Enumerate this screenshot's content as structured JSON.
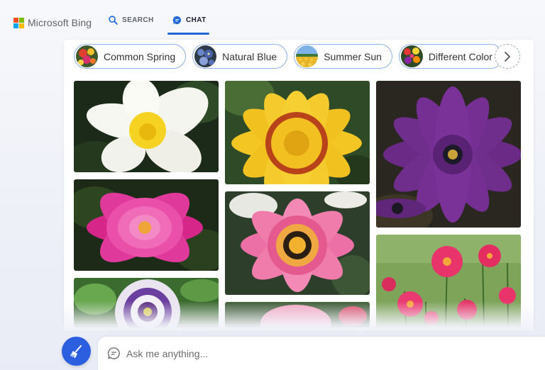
{
  "header": {
    "logo_text": "Microsoft Bing",
    "logo_colors": [
      "#f25022",
      "#7fba00",
      "#00a4ef",
      "#ffb900"
    ],
    "tabs": [
      {
        "label": "SEARCH",
        "active": false
      },
      {
        "label": "CHAT",
        "active": true
      }
    ],
    "accent": "#2267d8"
  },
  "chips": [
    {
      "label": "Common Spring",
      "thumb_icon": "spring-flowers-thumb"
    },
    {
      "label": "Natural Blue",
      "thumb_icon": "blue-flowers-thumb"
    },
    {
      "label": "Summer Sun",
      "thumb_icon": "sunflower-field-thumb"
    },
    {
      "label": "Different Color",
      "thumb_icon": "colorful-flowers-thumb"
    }
  ],
  "next_icon": "chevron-right-icon",
  "images": [
    {
      "name": "white-plumeria-image"
    },
    {
      "name": "yellow-gazania-image"
    },
    {
      "name": "purple-osteospermum-image"
    },
    {
      "name": "pink-dahlia-image"
    },
    {
      "name": "pink-gazania-image"
    },
    {
      "name": "passion-flower-image"
    },
    {
      "name": "pink-rose-image"
    },
    {
      "name": "pink-dahlia-garden-image"
    }
  ],
  "composer": {
    "placeholder": "Ask me anything...",
    "new_topic_icon": "broom-icon",
    "chat_icon": "chat-bubble-icon",
    "button_color": "#2c5fe0"
  }
}
